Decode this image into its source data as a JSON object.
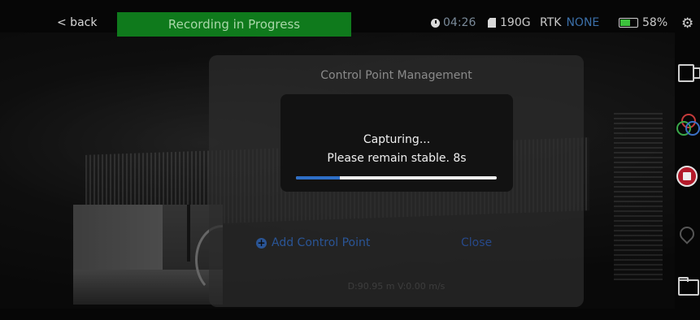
{
  "top_bar": {
    "back_label": "< back",
    "recording_banner": "Recording in Progress",
    "timer": "04:26",
    "storage": "190G",
    "rtk_label": "RTK",
    "rtk_status": "NONE",
    "battery": "58%",
    "battery_level": 0.58
  },
  "dialog": {
    "title": "Control Point Management",
    "add_button": "Add Control Point",
    "close_button": "Close",
    "readout": "D:90.95 m V:0.00 m/s"
  },
  "capture": {
    "line1": "Capturing...",
    "line2": "Please remain stable. 8s",
    "progress": 0.22
  },
  "icons": {
    "clock": "clock-icon",
    "storage": "sd-card-icon",
    "battery": "battery-icon",
    "settings": "gear-icon",
    "camera": "camera-icon",
    "layers": "layers-icon",
    "stop": "stop-record-icon",
    "location": "location-icon",
    "folder": "folder-icon",
    "add": "plus-icon"
  },
  "colors": {
    "recording": "#0f7a1c",
    "accent": "#2e6fc7",
    "stop": "#b21a2a",
    "battery": "#3cc23c"
  }
}
